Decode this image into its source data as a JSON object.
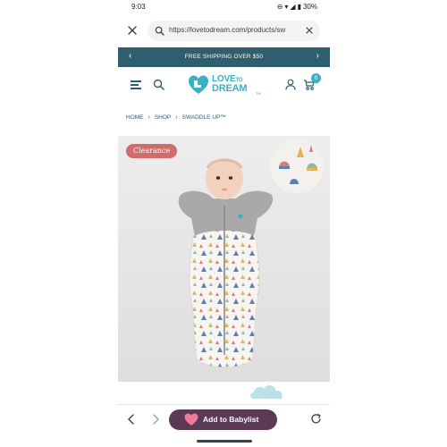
{
  "status_bar": {
    "time": "9:03",
    "battery": "30%",
    "icons": [
      "do-not-disturb-icon",
      "wifi-icon",
      "signal-icon",
      "battery-icon"
    ]
  },
  "browser": {
    "url": "https://lovetodream.com/products/sw",
    "close_icon": "close-icon",
    "search_icon": "search-icon",
    "clear_icon": "close-icon"
  },
  "banner": {
    "text": "FREE SHIPPING OVER $50",
    "prev_icon": "chevron-left-icon",
    "next_icon": "chevron-right-icon",
    "background": "#2f5e6e"
  },
  "header": {
    "logo_line1": "LOVE",
    "logo_to": "TO",
    "logo_line2": "DREAM",
    "logo_tm": "TM",
    "cart_count": "0",
    "accent": "#3ab0c4"
  },
  "breadcrumb": {
    "items": [
      "HOME",
      "SHOP",
      "SWADDLE UP™"
    ]
  },
  "product": {
    "badge": "Clearance",
    "badge_color": "#d36b6b"
  },
  "bottom_bar": {
    "babylist_label": "Add to Babylist",
    "babylist_color": "#5a3a54"
  }
}
